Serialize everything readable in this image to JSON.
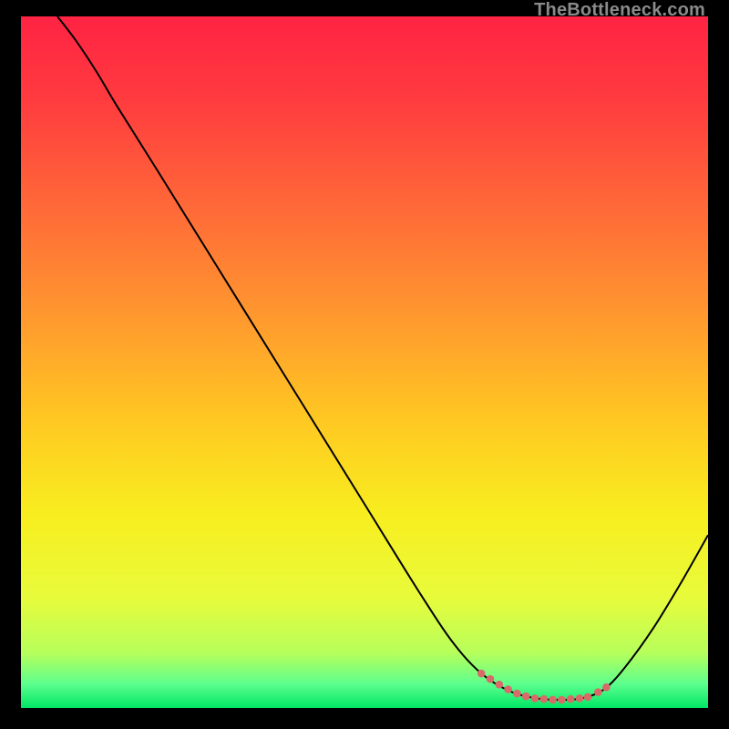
{
  "watermark": "TheBottleneck.com",
  "chart_data": {
    "type": "line",
    "title": "",
    "xlabel": "",
    "ylabel": "",
    "xlim": [
      0,
      100
    ],
    "ylim": [
      0,
      100
    ],
    "background_gradient": {
      "stops": [
        {
          "offset": 0.0,
          "color": "#ff2343"
        },
        {
          "offset": 0.12,
          "color": "#ff3b3f"
        },
        {
          "offset": 0.28,
          "color": "#ff6a38"
        },
        {
          "offset": 0.44,
          "color": "#ff9a2e"
        },
        {
          "offset": 0.58,
          "color": "#ffc722"
        },
        {
          "offset": 0.72,
          "color": "#f8ee1f"
        },
        {
          "offset": 0.84,
          "color": "#e8fb3b"
        },
        {
          "offset": 0.92,
          "color": "#b7ff5b"
        },
        {
          "offset": 0.965,
          "color": "#5dff8e"
        },
        {
          "offset": 1.0,
          "color": "#00e765"
        }
      ]
    },
    "series": [
      {
        "name": "bottleneck-curve",
        "color": "#000000",
        "width": 2,
        "x": [
          5.3,
          8.0,
          11.0,
          14.0,
          20.0,
          30.0,
          40.0,
          50.0,
          58.0,
          63.0,
          67.0,
          71.0,
          75.0,
          79.0,
          82.0,
          85.0,
          88.0,
          92.0,
          96.0,
          100.0
        ],
        "y": [
          100.0,
          96.5,
          92.0,
          87.0,
          77.5,
          61.5,
          45.5,
          29.5,
          16.7,
          9.3,
          5.0,
          2.5,
          1.4,
          1.2,
          1.5,
          2.8,
          6.0,
          11.5,
          18.0,
          25.0
        ]
      }
    ],
    "marker_band": {
      "name": "optimal-band",
      "color": "#d96a6a",
      "radius": 4.3,
      "x": [
        67.0,
        68.3,
        69.6,
        70.9,
        72.2,
        73.5,
        74.8,
        76.1,
        77.4,
        78.7,
        80.0,
        81.3,
        82.5,
        84.0,
        85.2
      ],
      "y": [
        5.0,
        4.2,
        3.4,
        2.7,
        2.1,
        1.7,
        1.4,
        1.3,
        1.2,
        1.2,
        1.3,
        1.4,
        1.6,
        2.3,
        3.0
      ]
    }
  }
}
